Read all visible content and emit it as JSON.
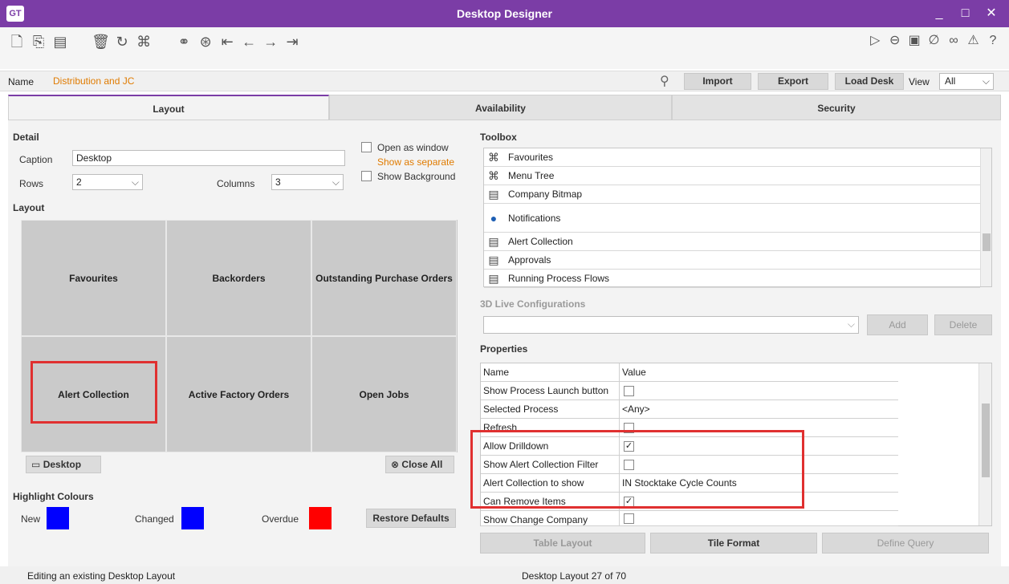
{
  "app": {
    "logo": "GT",
    "title": "Desktop Designer",
    "window_controls": [
      "_",
      "□",
      "✕"
    ]
  },
  "toolbar": {
    "left_icons": [
      "new-icon",
      "copy-icon",
      "save-icon",
      "delete-icon",
      "refresh-icon",
      "network-icon",
      "binoculars-icon",
      "find-icon",
      "first-icon",
      "prev-icon",
      "next-icon",
      "last-icon"
    ],
    "right_icons": [
      "play-icon",
      "back-circle-icon",
      "document-icon",
      "attach-icon",
      "link-icon",
      "warning-icon",
      "help-icon"
    ]
  },
  "name_row": {
    "label": "Name",
    "value": "Distribution and JC",
    "import": "Import",
    "export": "Export",
    "load_desk": "Load Desk",
    "view_label": "View",
    "view_value": "All"
  },
  "tabs": [
    {
      "label": "Layout",
      "active": true
    },
    {
      "label": "Availability",
      "active": false
    },
    {
      "label": "Security",
      "active": false
    }
  ],
  "detail": {
    "title": "Detail",
    "caption_label": "Caption",
    "caption_value": "Desktop",
    "rows_label": "Rows",
    "rows_value": "2",
    "columns_label": "Columns",
    "columns_value": "3",
    "open_as_window": "Open as window",
    "show_as_separate": "Show as separate",
    "show_background": "Show Background"
  },
  "layout": {
    "title": "Layout",
    "cells": [
      "Favourites",
      "Backorders",
      "Outstanding Purchase Orders",
      "Alert Collection",
      "Active Factory Orders",
      "Open Jobs"
    ],
    "desktop_button": "Desktop",
    "close_all_button": "Close All"
  },
  "highlight": {
    "title": "Highlight Colours",
    "new_label": "New",
    "changed_label": "Changed",
    "overdue_label": "Overdue",
    "new_color": "#0000ff",
    "changed_color": "#0000ff",
    "overdue_color": "#ff0000",
    "restore_button": "Restore Defaults"
  },
  "toolbox": {
    "title": "Toolbox",
    "items": [
      {
        "icon": "tree-icon",
        "label": "Favourites"
      },
      {
        "icon": "tree-icon",
        "label": "Menu Tree"
      },
      {
        "icon": "list-icon",
        "label": "Company Bitmap"
      },
      {
        "icon": "user-alert-icon",
        "label": "Notifications"
      },
      {
        "icon": "list-icon",
        "label": "Alert Collection"
      },
      {
        "icon": "list-icon",
        "label": "Approvals"
      },
      {
        "icon": "list-icon",
        "label": "Running Process Flows"
      }
    ]
  },
  "live3d": {
    "title": "3D Live Configurations",
    "add_button": "Add",
    "delete_button": "Delete"
  },
  "properties": {
    "title": "Properties",
    "header_name": "Name",
    "header_value": "Value",
    "rows": [
      {
        "name": "Show Process Launch button",
        "type": "check",
        "checked": false
      },
      {
        "name": "Selected Process",
        "type": "text",
        "value": "<Any>"
      },
      {
        "name": "Refresh",
        "type": "check",
        "checked": false
      },
      {
        "name": "Allow Drilldown",
        "type": "check",
        "checked": true
      },
      {
        "name": "Show Alert Collection Filter",
        "type": "check",
        "checked": false
      },
      {
        "name": "Alert Collection to show",
        "type": "text",
        "value": "IN Stocktake Cycle Counts"
      },
      {
        "name": "Can Remove Items",
        "type": "check",
        "checked": true
      },
      {
        "name": "Show Change Company",
        "type": "check",
        "checked": false
      }
    ],
    "table_layout_button": "Table Layout",
    "tile_format_button": "Tile Format",
    "define_query_button": "Define Query"
  },
  "status": {
    "left": "Editing an existing Desktop Layout",
    "center": "Desktop Layout 27 of 70"
  },
  "colors": {
    "accent": "#7b3da6",
    "highlight_red": "#e03030",
    "name_orange": "#e07b00"
  }
}
